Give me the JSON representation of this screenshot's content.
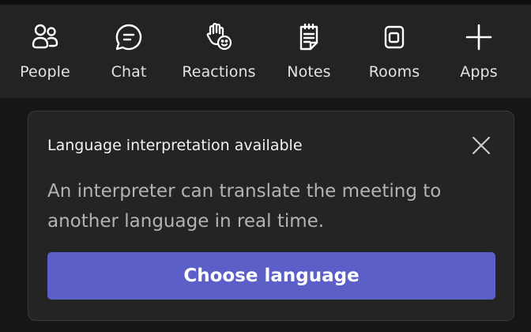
{
  "toolbar": {
    "items": [
      {
        "label": "People",
        "icon": "people-icon"
      },
      {
        "label": "Chat",
        "icon": "chat-icon"
      },
      {
        "label": "Reactions",
        "icon": "raised-hand-smile-icon"
      },
      {
        "label": "Notes",
        "icon": "notes-icon"
      },
      {
        "label": "Rooms",
        "icon": "rooms-icon"
      },
      {
        "label": "Apps",
        "icon": "plus-icon"
      }
    ]
  },
  "notification": {
    "title": "Language interpretation available",
    "message": "An interpreter can translate the meeting to another language in real time.",
    "button_label": "Choose language",
    "close_icon": "close-icon"
  },
  "colors": {
    "background": "#161616",
    "toolbar": "#232323",
    "card": "#242424",
    "accent": "#5b5fc7",
    "text_primary": "#f2f2f2",
    "text_secondary": "#b3b3b3"
  }
}
